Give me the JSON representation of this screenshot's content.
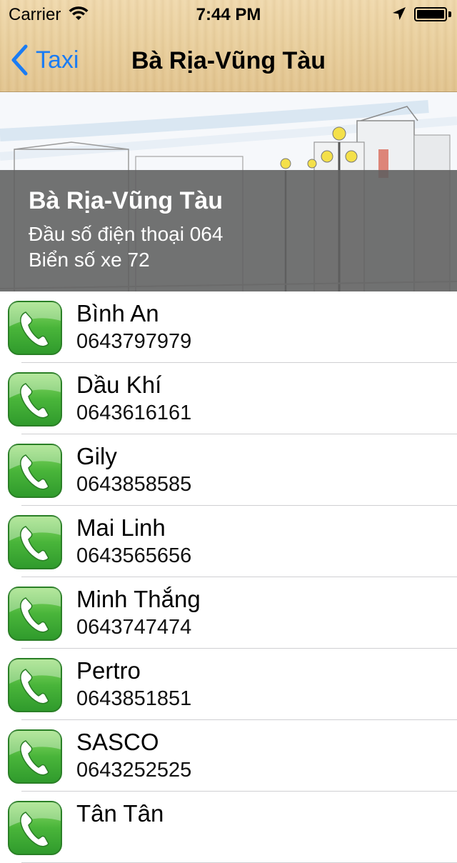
{
  "status_bar": {
    "carrier": "Carrier",
    "time": "7:44 PM",
    "icons": [
      "wifi-icon",
      "location-arrow-icon",
      "battery-icon"
    ]
  },
  "nav": {
    "back_label": "Taxi",
    "title": "Bà Rịa-Vũng Tàu"
  },
  "header": {
    "city": "Bà Rịa-Vũng Tàu",
    "area_code_line": "Đầu số điện thoại 064",
    "plate_line": "Biển số xe 72"
  },
  "taxis": [
    {
      "name": "Bình An",
      "phone": "0643797979"
    },
    {
      "name": "Dầu Khí",
      "phone": "0643616161"
    },
    {
      "name": "Gily",
      "phone": "0643858585"
    },
    {
      "name": "Mai Linh",
      "phone": "0643565656"
    },
    {
      "name": "Minh Thắng",
      "phone": "0643747474"
    },
    {
      "name": "Pertro",
      "phone": "0643851851"
    },
    {
      "name": "SASCO",
      "phone": "0643252525"
    },
    {
      "name": "Tân Tân",
      "phone": ""
    }
  ],
  "colors": {
    "accent": "#1a7cf4",
    "overlay": "#5f5f5f",
    "phone_green": "#3fae36"
  }
}
